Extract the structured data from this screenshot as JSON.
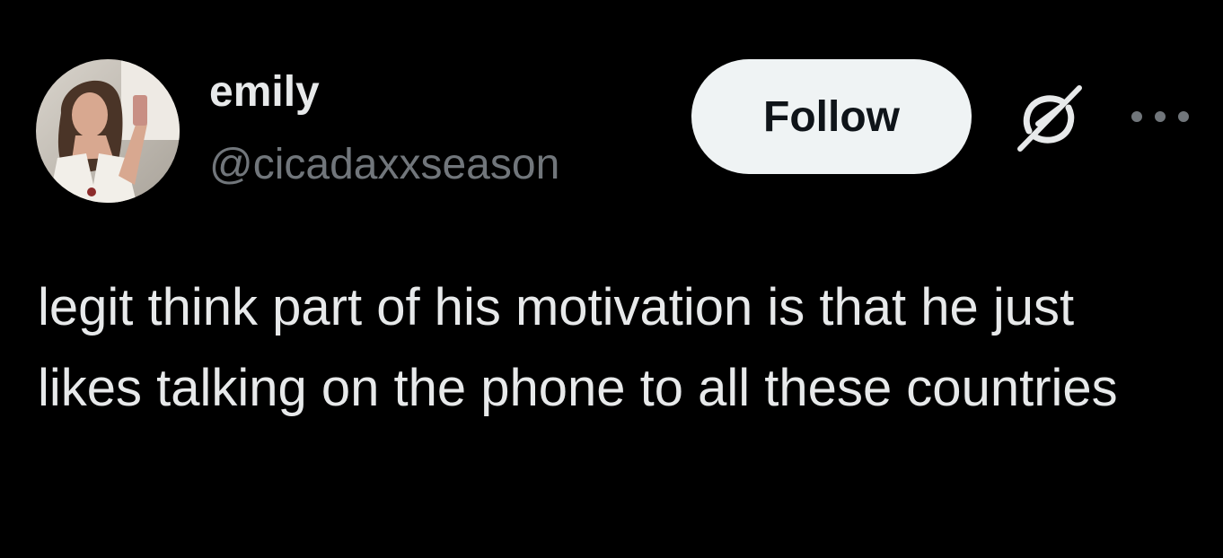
{
  "author": {
    "display_name": "emily",
    "handle": "@cicadaxxseason",
    "avatar": "profile-photo"
  },
  "actions": {
    "follow_label": "Follow",
    "grok_icon": "grok-icon",
    "more_icon": "more-options-icon"
  },
  "tweet": {
    "text": "legit think part of his motivation is that he just likes talking on the phone to all these countries"
  },
  "colors": {
    "background": "#000000",
    "primary_text": "#e7e9ea",
    "secondary_text": "#71767b",
    "follow_bg": "#eff3f4",
    "follow_text": "#0f1419"
  }
}
